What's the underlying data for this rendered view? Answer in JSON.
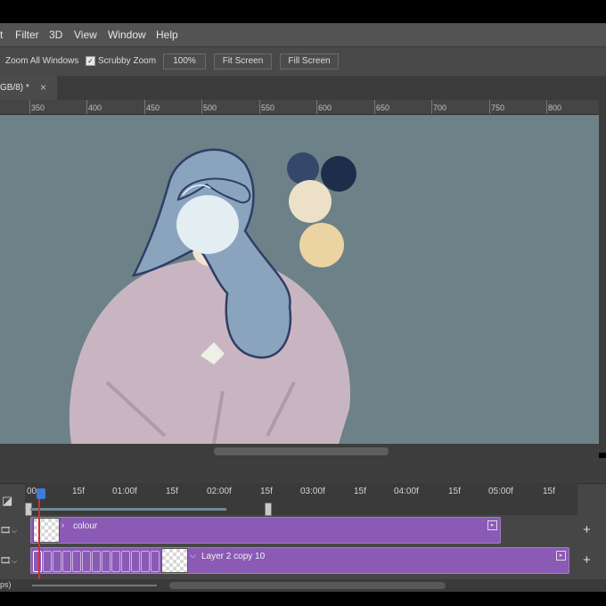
{
  "menubar": {
    "items": [
      "t",
      "Filter",
      "3D",
      "View",
      "Window",
      "Help"
    ]
  },
  "options_bar": {
    "zoom_all_windows": "Zoom All Windows",
    "scrubby_zoom": "Scrubby Zoom",
    "scrubby_zoom_checked": true,
    "zoom_value": "100%",
    "fit_screen": "Fit Screen",
    "fill_screen": "Fill Screen"
  },
  "document_tab": {
    "title": "GB/8) *",
    "close": "×"
  },
  "ruler": {
    "ticks": [
      "350",
      "400",
      "450",
      "500",
      "550",
      "600",
      "650",
      "700",
      "750",
      "800"
    ]
  },
  "canvas": {
    "background": "#6d8188",
    "palette_colors": [
      "#33486a",
      "#1d2d4a",
      "#ede0c9",
      "#ecd3a2"
    ]
  },
  "timeline": {
    "ticks": [
      "00",
      "15f",
      "01:00f",
      "15f",
      "02:00f",
      "15f",
      "03:00f",
      "15f",
      "04:00f",
      "15f",
      "05:00f",
      "15f"
    ],
    "tracks": [
      {
        "name": "colour"
      },
      {
        "name": "Layer 2 copy 10"
      }
    ],
    "track_color": "#8a5ab5",
    "bottom_label": "ps)"
  }
}
